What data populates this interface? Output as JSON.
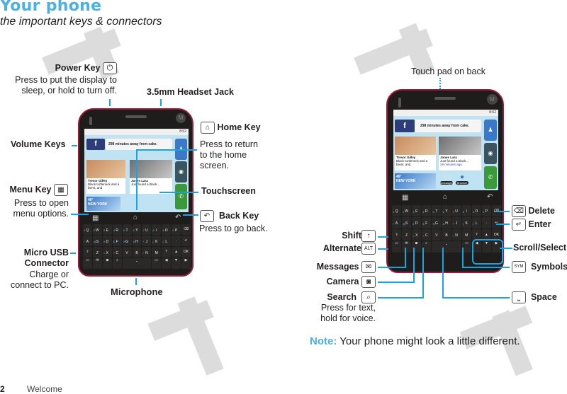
{
  "page": {
    "title": "Your phone",
    "subtitle": "the important keys & connectors",
    "footer_page_number": "2",
    "footer_section": "Welcome",
    "accent_color": "#4bb0e4",
    "callout_color": "#1aa3de",
    "phone_border_color": "#9b1b3b"
  },
  "front_callouts": {
    "power_key": {
      "title": "Power Key",
      "icon": "power-icon",
      "desc": "Press to put the display to sleep, or hold to turn off."
    },
    "headset_jack": {
      "title": "3.5mm Headset Jack"
    },
    "volume_keys": {
      "title": "Volume Keys"
    },
    "home_key": {
      "title": "Home Key",
      "icon": "home-icon",
      "desc": "Press to return to the home screen."
    },
    "touchscreen": {
      "title": "Touchscreen"
    },
    "menu_key": {
      "title": "Menu Key",
      "icon": "menu-icon",
      "desc": "Press to open menu options."
    },
    "back_key": {
      "title": "Back Key",
      "icon": "back-icon",
      "desc": "Press to go back."
    },
    "micro_usb": {
      "title_line1": "Micro USB",
      "title_line2": "Connector",
      "desc_line1": "Charge or",
      "desc_line2": "connect to PC."
    },
    "microphone": {
      "title": "Microphone"
    }
  },
  "keyboard_callouts": {
    "touch_pad": {
      "title": "Touch pad on back"
    },
    "delete": {
      "title": "Delete",
      "icon": "delete-icon"
    },
    "enter": {
      "title": "Enter",
      "icon": "enter-icon"
    },
    "shift": {
      "title": "Shift",
      "icon": "shift-icon"
    },
    "alternate": {
      "title": "Alternate",
      "icon_text": "ALT"
    },
    "scroll_select": {
      "title": "Scroll/Select"
    },
    "messages": {
      "title": "Messages",
      "icon": "envelope-icon"
    },
    "symbols": {
      "title": "Symbols",
      "icon_text": "SYM"
    },
    "camera": {
      "title": "Camera",
      "icon": "camera-icon"
    },
    "search": {
      "title": "Search",
      "icon": "search-icon",
      "desc_line1": "Press for text,",
      "desc_line2": "hold for voice."
    },
    "space": {
      "title": "Space",
      "icon": "space-icon"
    }
  },
  "note": {
    "label": "Note:",
    "text": "Your phone might look a little different."
  },
  "phone_screen": {
    "time": "8:52",
    "facebook_status": "298 minutes away from cake.",
    "card1_name": "Trevor Gilley",
    "card1_text": "Black turtleneck and a beret, and",
    "card2_name": "Jones Lara",
    "card2_text": "Just found a black...",
    "card2_time": "28 minutes ago",
    "weather_temp": "46°",
    "weather_city": "NEW YORK",
    "app1": "Messaging",
    "app2": "Browser"
  },
  "keyboard": {
    "row1": [
      [
        "Q",
        "1"
      ],
      [
        "W",
        "2"
      ],
      [
        "E",
        "3"
      ],
      [
        "R",
        "4"
      ],
      [
        "T",
        "5"
      ],
      [
        "Y",
        "6"
      ],
      [
        "U",
        "7"
      ],
      [
        "I",
        "8"
      ],
      [
        "O",
        "9"
      ],
      [
        "P",
        "0"
      ]
    ],
    "row2": [
      [
        "A",
        "!"
      ],
      [
        "S",
        "@"
      ],
      [
        "D",
        "#"
      ],
      [
        "F",
        "$"
      ],
      [
        "G",
        "%"
      ],
      [
        "H",
        "&"
      ],
      [
        "J",
        "*"
      ],
      [
        "K",
        "("
      ],
      [
        "L",
        ")"
      ]
    ],
    "row3": [
      [
        "Z",
        "-"
      ],
      [
        "X",
        "="
      ],
      [
        "C",
        "+"
      ],
      [
        "V",
        ""
      ],
      [
        "B",
        ""
      ],
      [
        "N",
        "/"
      ],
      [
        "M",
        ""
      ]
    ]
  }
}
